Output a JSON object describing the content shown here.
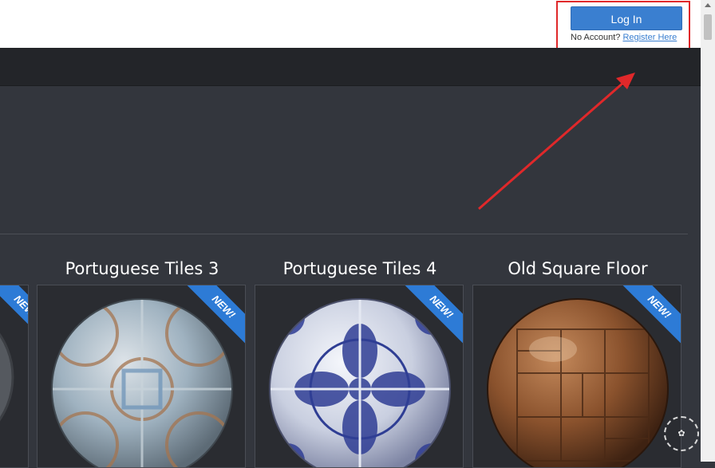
{
  "header": {
    "login_label": "Log In",
    "no_account_text": "No Account?",
    "register_link": "Register Here"
  },
  "materials": [
    {
      "title": "Portuguese Tiles 3",
      "badge": "NEW!"
    },
    {
      "title": "Portuguese Tiles 4",
      "badge": "NEW!"
    },
    {
      "title": "Old Square Floor",
      "badge": "NEW!"
    }
  ],
  "partial_card": {
    "badge": "NEW!"
  },
  "colors": {
    "login_button": "#3a7fd0",
    "highlight": "#e0282a",
    "badge": "#2d7bd6"
  }
}
